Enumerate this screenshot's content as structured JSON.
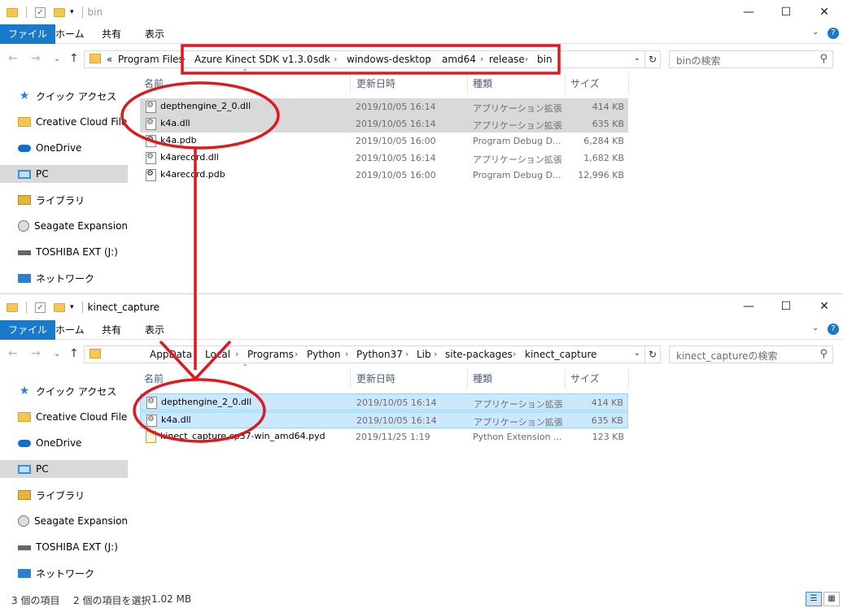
{
  "window1": {
    "title": "bin",
    "ribbon": {
      "file": "ファイル",
      "home": "ホーム",
      "share": "共有",
      "view": "表示"
    },
    "address": {
      "overflow": "«",
      "segments": [
        "Program Files",
        "Azure Kinect SDK v1.3.0",
        "sdk",
        "windows-desktop",
        "amd64",
        "release",
        "bin"
      ]
    },
    "search_placeholder": "binの検索",
    "columns": {
      "name": "名前",
      "date": "更新日時",
      "type": "種類",
      "size": "サイズ"
    },
    "files": [
      {
        "name": "depthengine_2_0.dll",
        "date": "2019/10/05 16:14",
        "type": "アプリケーション拡張",
        "size": "414 KB",
        "icon": "dll-icon"
      },
      {
        "name": "k4a.dll",
        "date": "2019/10/05 16:14",
        "type": "アプリケーション拡張",
        "size": "635 KB",
        "icon": "dll-icon"
      },
      {
        "name": "k4a.pdb",
        "date": "2019/10/05 16:00",
        "type": "Program Debug D...",
        "size": "6,284 KB",
        "icon": "pdb-icon"
      },
      {
        "name": "k4arecord.dll",
        "date": "2019/10/05 16:14",
        "type": "アプリケーション拡張",
        "size": "1,682 KB",
        "icon": "dll-icon"
      },
      {
        "name": "k4arecord.pdb",
        "date": "2019/10/05 16:00",
        "type": "Program Debug D...",
        "size": "12,996 KB",
        "icon": "pdb-icon"
      }
    ]
  },
  "window2": {
    "title": "kinect_capture",
    "ribbon": {
      "file": "ファイル",
      "home": "ホーム",
      "share": "共有",
      "view": "表示"
    },
    "address": {
      "segments": [
        "AppData",
        "Local",
        "Programs",
        "Python",
        "Python37",
        "Lib",
        "site-packages",
        "kinect_capture"
      ]
    },
    "search_placeholder": "kinect_captureの検索",
    "columns": {
      "name": "名前",
      "date": "更新日時",
      "type": "種類",
      "size": "サイズ"
    },
    "files": [
      {
        "name": "depthengine_2_0.dll",
        "date": "2019/10/05 16:14",
        "type": "アプリケーション拡張",
        "size": "414 KB",
        "icon": "dll-icon"
      },
      {
        "name": "k4a.dll",
        "date": "2019/10/05 16:14",
        "type": "アプリケーション拡張",
        "size": "635 KB",
        "icon": "dll-icon"
      },
      {
        "name": "kinect_capture.cp37-win_amd64.pyd",
        "date": "2019/11/25 1:19",
        "type": "Python Extension ...",
        "size": "123 KB",
        "icon": "pyd-icon"
      }
    ],
    "status": {
      "count": "3 個の項目",
      "selected": "2 個の項目を選択",
      "size": "1.02 MB"
    }
  },
  "nav_items": [
    {
      "label": "クイック アクセス",
      "icon": "star-icon"
    },
    {
      "label": "Creative Cloud Files",
      "icon": "folder-icon"
    },
    {
      "label": "OneDrive",
      "icon": "cloud-icon"
    },
    {
      "label": "PC",
      "icon": "pc-icon"
    },
    {
      "label": "ライブラリ",
      "icon": "library-icon"
    },
    {
      "label": "Seagate Expansion Dr",
      "icon": "drive-icon"
    },
    {
      "label": "TOSHIBA EXT (J:)",
      "icon": "usb-drive-icon"
    },
    {
      "label": "ネットワーク",
      "icon": "network-icon"
    }
  ],
  "colors": {
    "accent": "#1979ca",
    "annotation": "#e0191f",
    "selection_gray": "#d9d9d9",
    "selection_blue": "#cce8ff"
  }
}
